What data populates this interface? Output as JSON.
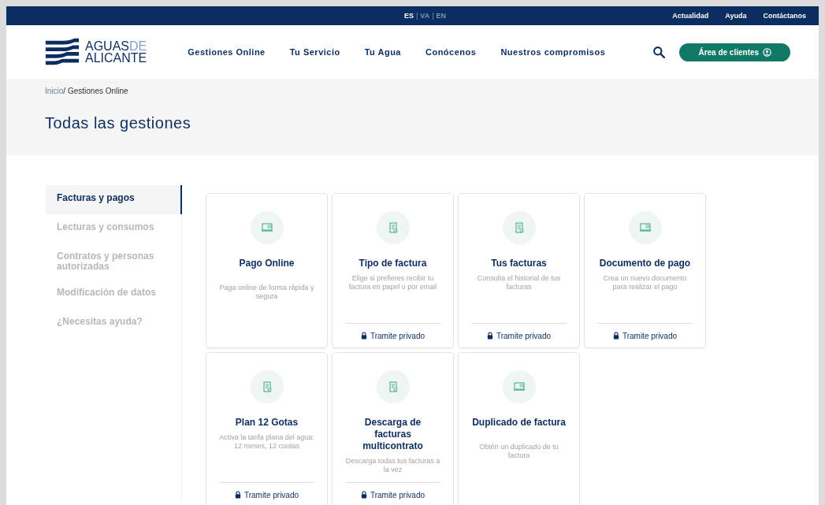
{
  "top_bar": {
    "languages": [
      {
        "label": "ES",
        "selected": true
      },
      {
        "label": "VA",
        "selected": false
      },
      {
        "label": "EN",
        "selected": false
      }
    ],
    "separator": "|",
    "links": [
      "Actualidad",
      "Ayuda",
      "Contáctanos"
    ]
  },
  "header": {
    "logo": {
      "line1": "AGUAS",
      "line1_suffix": "DE",
      "line2": "ALICANTE"
    },
    "nav": [
      "Gestiones Online",
      "Tu Servicio",
      "Tu Agua",
      "Conócenos",
      "Nuestros compromisos"
    ],
    "client_button": "Área de clientes"
  },
  "breadcrumb": {
    "items": [
      "Inicio",
      "Gestiones Online"
    ],
    "separator": "/"
  },
  "page_title": "Todas las gestiones",
  "sidebar": {
    "items": [
      {
        "label": "Facturas y pagos",
        "selected": true
      },
      {
        "label": "Lecturas y consumos",
        "selected": false
      },
      {
        "label": "Contratos y personas autorizadas",
        "selected": false
      },
      {
        "label": "Modificación de datos",
        "selected": false
      },
      {
        "label": "¿Necesitas ayuda?",
        "selected": false
      }
    ]
  },
  "cards": [
    {
      "title": "Pago Online",
      "description": "Paga online de forma rápida y segura"
    },
    {
      "title": "Tipo de factura",
      "description": "Elige si prefieres recibir tu factura en papel o por email",
      "footer": "Tramite privado"
    },
    {
      "title": "Tus facturas",
      "description": "Consulta el historial de tus facturas",
      "footer": "Tramite privado"
    },
    {
      "title": "Documento de pago",
      "description": "Crea un nuevo documento para realizar el pago",
      "footer": "Tramite privado"
    },
    {
      "title": "Plan 12 Gotas",
      "description": "Activa la tarifa plana del agua: 12 meses, 12 cuotas",
      "footer": "Tramite privado"
    },
    {
      "title": "Descarga de facturas multicontrato",
      "description": "Descarga todas tus facturas a la vez",
      "footer": "Tramite privado"
    },
    {
      "title": "Duplicado de factura",
      "description": "Obtén un duplicado de tu factura"
    }
  ]
}
